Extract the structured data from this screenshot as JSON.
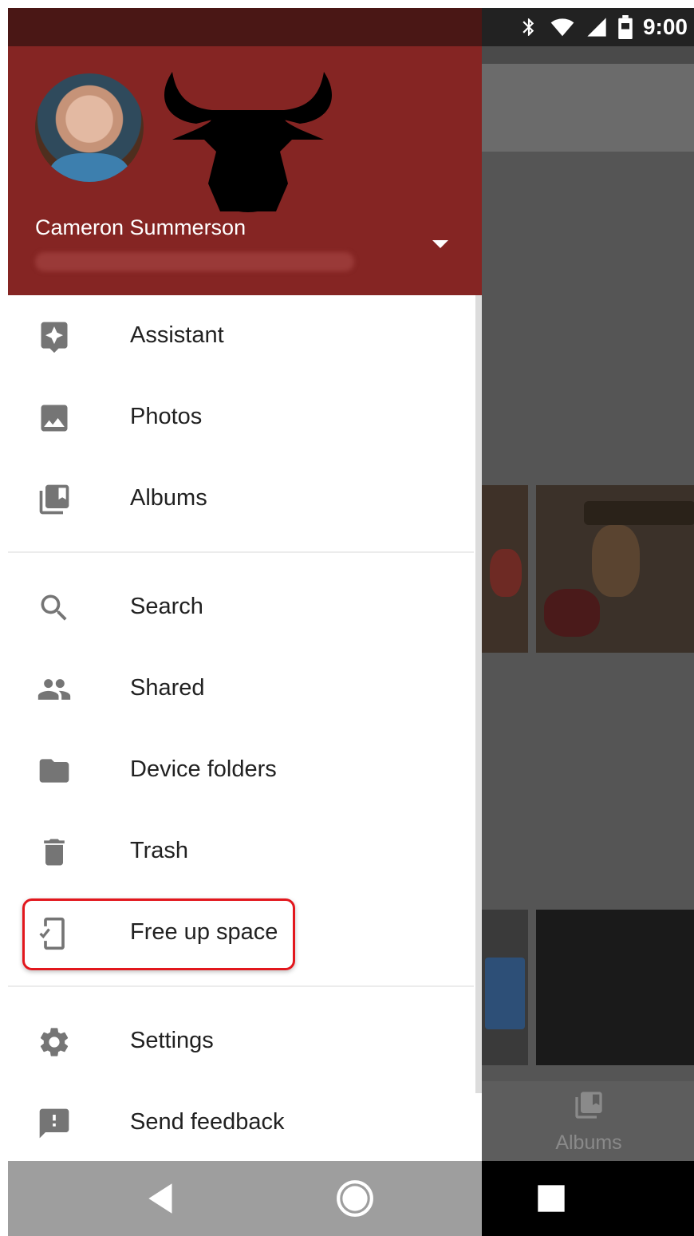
{
  "status_bar": {
    "time": "9:00",
    "icons": [
      "bluetooth-icon",
      "wifi-icon",
      "signal-icon",
      "battery-icon"
    ]
  },
  "drawer": {
    "account": {
      "name": "Cameron Summerson",
      "avatar": "avatar-icon",
      "header_color": "#852523"
    },
    "sections": [
      {
        "items": [
          {
            "label": "Assistant",
            "icon": "assistant-icon"
          },
          {
            "label": "Photos",
            "icon": "photo-icon"
          },
          {
            "label": "Albums",
            "icon": "albums-icon"
          }
        ]
      },
      {
        "items": [
          {
            "label": "Search",
            "icon": "search-icon"
          },
          {
            "label": "Shared",
            "icon": "people-icon"
          },
          {
            "label": "Device folders",
            "icon": "folder-icon"
          },
          {
            "label": "Trash",
            "icon": "trash-icon"
          },
          {
            "label": "Free up space",
            "icon": "free-up-space-icon",
            "highlighted": true
          }
        ]
      },
      {
        "items": [
          {
            "label": "Settings",
            "icon": "gear-icon"
          },
          {
            "label": "Send feedback",
            "icon": "feedback-icon"
          }
        ]
      }
    ]
  },
  "background_app": {
    "bottom_nav": {
      "albums_label": "Albums"
    }
  },
  "colors": {
    "highlight": "#e2171d",
    "icon": "#757575",
    "text": "#212121"
  }
}
